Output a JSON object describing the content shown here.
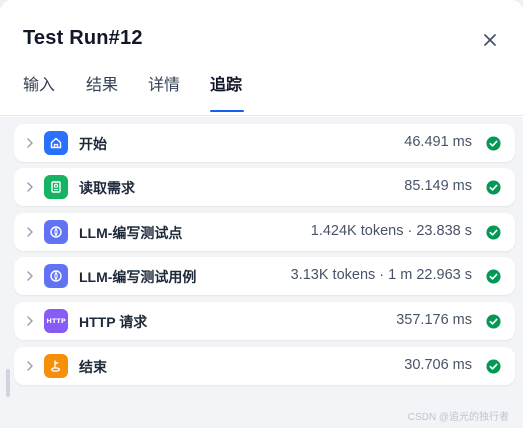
{
  "title": "Test Run#12",
  "tabs": [
    "输入",
    "结果",
    "详情",
    "追踪"
  ],
  "active_tab": "追踪",
  "nodes": [
    {
      "name": "开始",
      "meta": "46.491 ms",
      "icon": "home-icon",
      "color": "#2970ff",
      "status": "success"
    },
    {
      "name": "读取需求",
      "meta": "85.149 ms",
      "icon": "knowledge-book-icon",
      "color": "#16b364",
      "status": "success"
    },
    {
      "name": "LLM-编写测试点",
      "meta": "1.424K tokens · 23.838 s",
      "icon": "llm-icon",
      "color": "#6172f3",
      "status": "success"
    },
    {
      "name": "LLM-编写测试用例",
      "meta": "3.13K tokens · 1 m 22.963 s",
      "icon": "llm-icon",
      "color": "#6172f3",
      "status": "success"
    },
    {
      "name": "HTTP 请求",
      "meta": "357.176 ms",
      "icon": "http-icon",
      "icon_text": "HTTP",
      "color": "#875bf7",
      "status": "success"
    },
    {
      "name": "结束",
      "meta": "30.706 ms",
      "icon": "end-flag-icon",
      "color": "#f79009",
      "status": "success"
    }
  ],
  "status_color": "#039855",
  "watermark": "CSDN @追光的独行者"
}
